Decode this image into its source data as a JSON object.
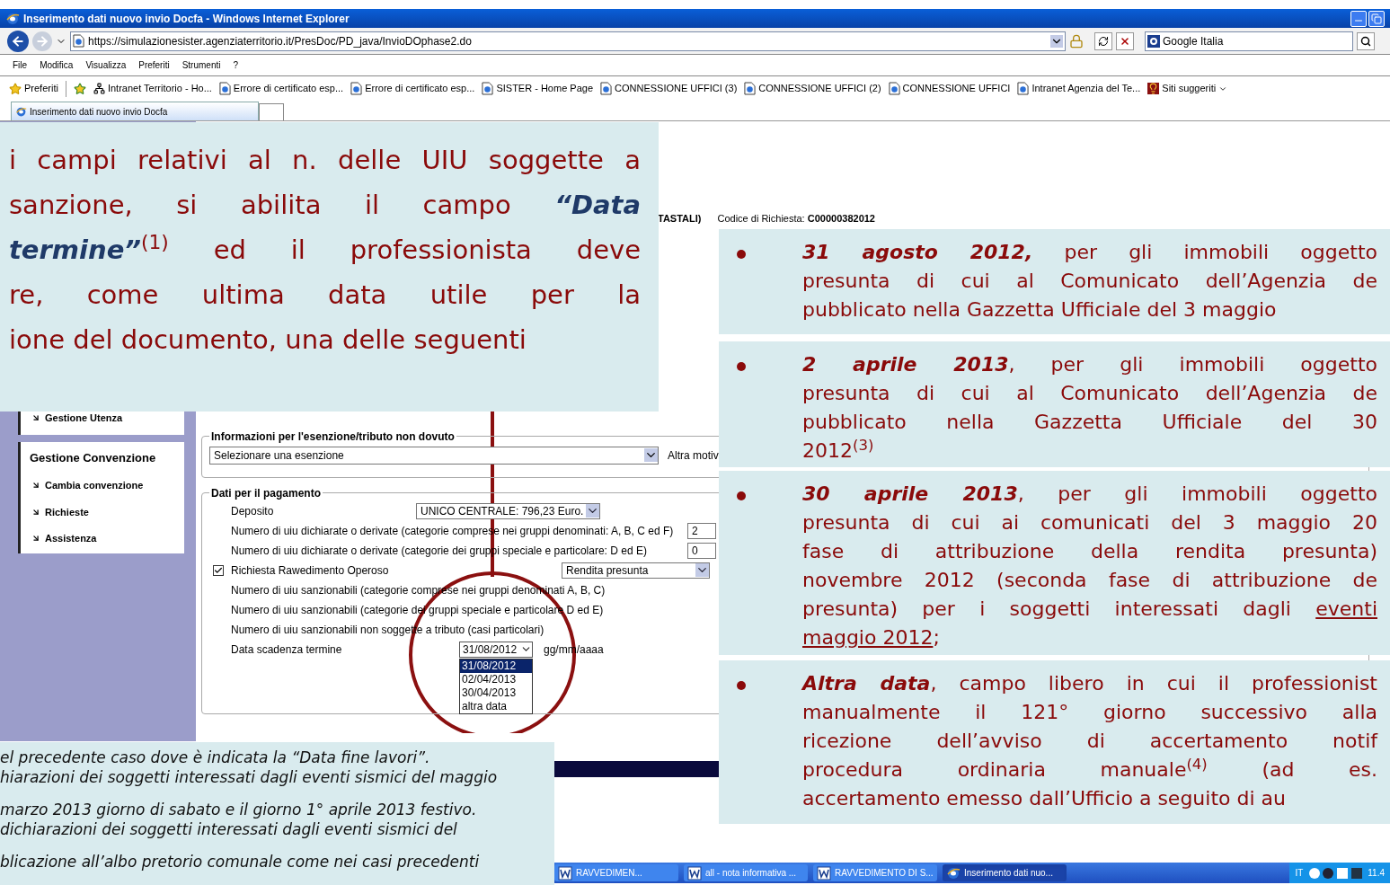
{
  "window": {
    "title": "Inserimento dati nuovo invio Docfa - Windows Internet Explorer"
  },
  "address_bar": {
    "url": "https://simulazionesister.agenziaterritorio.it/PresDoc/PD_java/InvioDOphase2.do"
  },
  "search": {
    "value": "Google Italia"
  },
  "menu": [
    "File",
    "Modifica",
    "Visualizza",
    "Preferiti",
    "Strumenti",
    "?"
  ],
  "favorites": {
    "label": "Preferiti",
    "items": [
      {
        "kind": "network",
        "label": "Intranet Territorio - Ho..."
      },
      {
        "kind": "page",
        "label": "Errore di certificato esp..."
      },
      {
        "kind": "page",
        "label": "Errore di certificato esp..."
      },
      {
        "kind": "page",
        "label": "SISTER - Home Page"
      },
      {
        "kind": "page",
        "label": "CONNESSIONE UFFICI (3)"
      },
      {
        "kind": "page",
        "label": "CONNESSIONE UFFICI (2)"
      },
      {
        "kind": "page",
        "label": "CONNESSIONE UFFICI"
      },
      {
        "kind": "page",
        "label": "Intranet Agenzia del Te..."
      },
      {
        "kind": "suggested",
        "label": "Siti suggeriti"
      }
    ]
  },
  "tab": {
    "label": "Inserimento dati nuovo invio Docfa"
  },
  "sidebar": {
    "items": [
      "Gestione Utenza"
    ],
    "section": {
      "title": "Gestione Convenzione",
      "items": [
        "Cambia convenzione",
        "Richieste",
        "Assistenza"
      ]
    }
  },
  "header": {
    "fragment": "TASTALI)",
    "request_label": "Codice di Richiesta:",
    "request_code": "C00000382012"
  },
  "exemption": {
    "legend": "Informazioni per l'esenzione/tributo non dovuto",
    "select": "Selezionare una esenzione",
    "side_label": "Altra motiv"
  },
  "payment": {
    "legend": "Dati per il pagamento",
    "rows": [
      {
        "kind": "select",
        "label": "Deposito",
        "value": "UNICO CENTRALE: 796,23 Euro."
      },
      {
        "kind": "input",
        "label": "Numero di uiu dichiarate o derivate (categorie comprese nei gruppi denominati: A, B, C ed F)",
        "value": "2"
      },
      {
        "kind": "input",
        "label": "Numero di uiu dichiarate o derivate (categorie dei gruppi speciale e particolare: D ed E)",
        "value": "0"
      },
      {
        "kind": "checkbox",
        "label": "Richiesta Rawedimento Operoso",
        "checked": true,
        "value": "Rendita presunta"
      },
      {
        "kind": "text",
        "label": "Numero di uiu sanzionabili (categorie comprese nei gruppi denominati A, B, C)"
      },
      {
        "kind": "text",
        "label": "Numero di uiu sanzionabili (categorie dei gruppi speciale e particolare D ed E)"
      },
      {
        "kind": "text",
        "label": "Numero di uiu sanzionabili non soggette a tributo (casi particolari)"
      },
      {
        "kind": "date",
        "label": "Data scadenza termine",
        "value": "31/08/2012",
        "hint": "gg/mm/aaaa",
        "options": [
          {
            "label": "31/08/2012",
            "selected": true
          },
          {
            "label": "02/04/2013",
            "selected": false
          },
          {
            "label": "30/04/2013",
            "selected": false
          },
          {
            "label": "altra data",
            "selected": false
          }
        ]
      }
    ]
  },
  "callouts": {
    "top": {
      "lines": [
        [
          {
            "kind": "plain",
            "text": "i campi relativi al n. delle UIU soggette a"
          }
        ],
        [
          {
            "kind": "plain",
            "text": "sanzione, si abilita il campo "
          },
          {
            "kind": "lead",
            "text": "“Data"
          }
        ],
        [
          {
            "kind": "lead",
            "text": "termine”"
          },
          {
            "kind": "plain",
            "text": "$^{(1)}$ ed il professionista deve"
          }
        ],
        [
          {
            "kind": "plain",
            "text": "re, come ultima data utile per la"
          }
        ],
        [
          {
            "kind": "plain",
            "text": "ione del documento, una delle seguenti"
          }
        ]
      ]
    },
    "right": [
      {
        "lines": [
          [
            {
              "kind": "lead",
              "text": "31 agosto 2012,"
            },
            {
              "kind": "plain",
              "text": " per gli immobili oggetto"
            }
          ],
          [
            {
              "kind": "plain",
              "text": "presunta di cui al Comunicato dell’Agenzia de"
            }
          ],
          [
            {
              "kind": "plain",
              "text": "pubblicato nella Gazzetta Ufficiale del 3 maggio"
            }
          ]
        ]
      },
      {
        "lines": [
          [
            {
              "kind": "lead",
              "text": "2 aprile 2013"
            },
            {
              "kind": "plain",
              "text": ", per gli immobili oggetto"
            }
          ],
          [
            {
              "kind": "plain",
              "text": "presunta di cui al Comunicato dell’Agenzia de"
            }
          ],
          [
            {
              "kind": "plain",
              "text": "pubblicato nella Gazzetta Ufficiale del 30"
            }
          ],
          [
            {
              "kind": "plain",
              "text": "2012$^{(3)}$"
            }
          ]
        ]
      },
      {
        "lines": [
          [
            {
              "kind": "lead",
              "text": "30 aprile 2013"
            },
            {
              "kind": "plain",
              "text": ", per gli immobili oggetto"
            }
          ],
          [
            {
              "kind": "plain",
              "text": "presunta di cui ai comunicati del 3 maggio 20"
            }
          ],
          [
            {
              "kind": "plain",
              "text": "fase di attribuzione della rendita presunta)"
            }
          ],
          [
            {
              "kind": "plain",
              "text": "novembre 2012 (seconda fase di attribuzione de"
            }
          ],
          [
            {
              "kind": "plain",
              "text": "presunta) per i soggetti interessati dagli "
            },
            {
              "kind": "link",
              "text": "eventi"
            }
          ],
          [
            {
              "kind": "link",
              "text": "maggio 2012"
            },
            {
              "kind": "plain",
              "text": ";"
            }
          ]
        ]
      },
      {
        "lines": [
          [
            {
              "kind": "lead",
              "text": "Altra data"
            },
            {
              "kind": "plain",
              "text": ", campo libero in cui il professionist"
            }
          ],
          [
            {
              "kind": "plain",
              "text": "manualmente il 121° giorno successivo alla"
            }
          ],
          [
            {
              "kind": "plain",
              "text": "ricezione dell’avviso di accertamento notif"
            }
          ],
          [
            {
              "kind": "plain",
              "text": "procedura ordinaria manuale$^{(4)}$ (ad es."
            }
          ],
          [
            {
              "kind": "plain",
              "text": "accertamento emesso dall’Ufficio a seguito di au"
            }
          ]
        ]
      }
    ],
    "bottom": {
      "paragraphs": [
        [
          "el precedente caso dove è indicata la “Data fine lavori”.",
          "hiarazioni dei soggetti interessati dagli eventi sismici del maggio"
        ],
        [
          "marzo 2013 giorno di sabato e il giorno 1° aprile 2013 festivo.",
          "dichiarazioni dei soggetti interessati dagli eventi sismici del"
        ],
        [
          "blicazione all’albo pretorio comunale come nei casi precedenti"
        ]
      ]
    }
  },
  "taskbar": {
    "items": [
      {
        "kind": "word",
        "label": "RAVVEDIMEN...",
        "selected": false
      },
      {
        "kind": "word",
        "label": "all - nota informativa ...",
        "selected": false
      },
      {
        "kind": "word",
        "label": "RAVVEDIMENTO DI S...",
        "selected": false
      },
      {
        "kind": "browser",
        "label": "Inserimento dati nuo...",
        "selected": true
      }
    ],
    "language": "IT",
    "clock": "11.4"
  }
}
